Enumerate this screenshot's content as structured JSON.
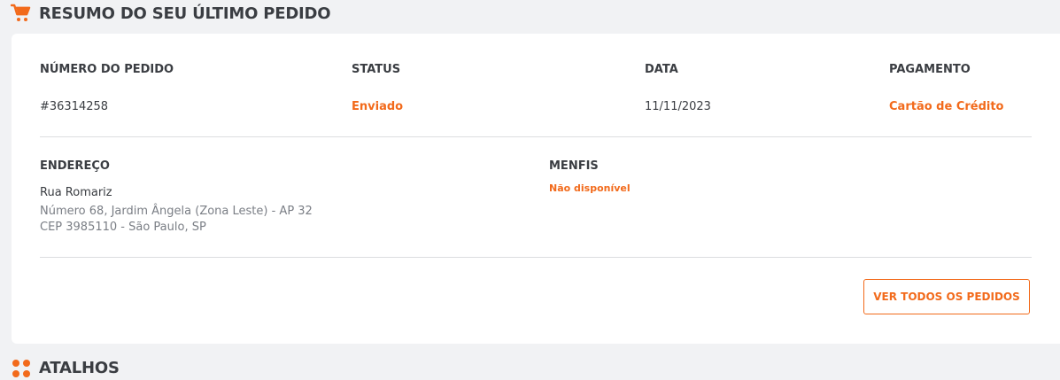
{
  "summary": {
    "title": "RESUMO DO SEU ÚLTIMO PEDIDO",
    "icon": "shopping-cart-icon",
    "accent_color": "#f26a1b",
    "order": {
      "number_label": "NÚMERO DO PEDIDO",
      "number_value": "#36314258",
      "status_label": "STATUS",
      "status_value": "Enviado",
      "date_label": "DATA",
      "date_value": "11/11/2023",
      "payment_label": "PAGAMENTO",
      "payment_value": "Cartão de Crédito"
    },
    "address": {
      "label": "ENDEREÇO",
      "street": "Rua Romariz",
      "line2": "Número 68, Jardim Ângela (Zona Leste) - AP 32",
      "line3": "CEP 3985110 - São Paulo, SP"
    },
    "menfis": {
      "label": "MENFIS",
      "value": "Não disponível"
    },
    "view_all_button": "VER TODOS OS PEDIDOS"
  },
  "shortcuts": {
    "title": "ATALHOS",
    "icon": "grid-dots-icon"
  }
}
